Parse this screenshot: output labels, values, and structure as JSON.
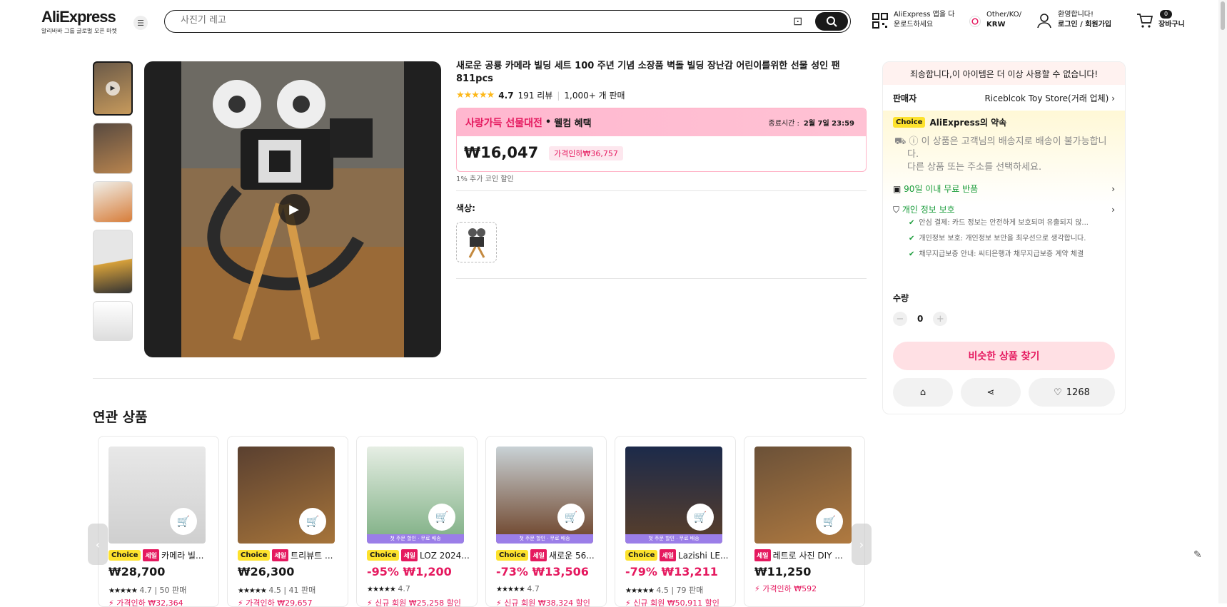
{
  "header": {
    "logo": "AliExpress",
    "logo_sub": "알리바바 그룹 글로벌 오픈 마켓",
    "search_placeholder": "사진기 레고",
    "app_line1": "AliExpress 앱을 다",
    "app_line2": "운로드하세요",
    "lang_line1": "Other/KO/",
    "lang_line2": "KRW",
    "user_line1": "환영합니다!",
    "user_line2": "로그인 / 회원가입",
    "cart_count": "0",
    "cart_label": "장바구니"
  },
  "product": {
    "title": "새로운 공룡 카메라 빌딩 세트 100 주년 기념 소장품 벽돌 빌딩 장난감 어린이를위한 선물 성인 팬 811pcs",
    "rating": "4.7",
    "reviews": "191 리뷰",
    "sold": "1,000+ 개 판매",
    "promo_brand": "사랑가득 선물대전",
    "promo_sep": "•",
    "promo_welcome": "웰컴 혜택",
    "end_label": "종료시간 :",
    "end_time": "2월 7일 23:59",
    "price": "₩16,047",
    "discount": "가격인하₩36,757",
    "coin": "1% 추가 코인 할인",
    "color_label": "색상:"
  },
  "panel": {
    "notice": "죄송합니다,이 아이템은 더 이상 사용할 수 없습니다!",
    "seller_label": "판매자",
    "seller_name": "Riceblcok Toy Store(거래 업체)",
    "choice_chip": "Choice",
    "promise": "AliExpress의 약속",
    "ship_line1": "이 상품은 고객님의 배송지로 배송이 불가능합니",
    "ship_line2": "다.",
    "ship_line3": "다른 상품 또는 주소를 선택하세요.",
    "returns": "90일 이내 무료 반품",
    "privacy": "개인 정보 보호",
    "privacy_items": [
      "안심 결제: 카드 정보는 안전하게 보호되며 유출되지 않...",
      "개인정보 보호: 개인정보 보안을 최우선으로 생각합니다.",
      "채무지급보증 안내: 씨티은행과 채무지급보증 계약 체결"
    ],
    "qty_label": "수량",
    "qty_value": "0",
    "similar_btn": "비슷한 상품 찾기",
    "wishlist_count": "1268"
  },
  "related": {
    "title": "연관 상품",
    "banner_text": "첫 주문 할인 · 무료 배송",
    "items": [
      {
        "name": "카메라 빌...",
        "price": "₩28,700",
        "rating": "4.7",
        "sold": "50 판매",
        "disc": "가격인하 ₩32,364"
      },
      {
        "name": "트리뷰트 ...",
        "price": "₩26,300",
        "rating": "4.5",
        "sold": "41 판매",
        "disc": "가격인하 ₩29,657"
      },
      {
        "name": "LOZ 2024...",
        "pct": "-95%",
        "price": "₩1,200",
        "rating": "4.7",
        "sold": "",
        "disc": "신규 회원 ₩25,258 할인"
      },
      {
        "name": "새로운 56...",
        "pct": "-73%",
        "price": "₩13,506",
        "rating": "4.7",
        "sold": "",
        "disc": "신규 회원 ₩38,324 할인"
      },
      {
        "name": "Lazishi LE...",
        "pct": "-79%",
        "price": "₩13,211",
        "rating": "4.5",
        "sold": "79 판매",
        "disc": "신규 회원 ₩50,911 할인"
      },
      {
        "name": "레트로 사진 DIY ...",
        "price": "₩11,250",
        "rating": "",
        "sold": "",
        "disc": "가격인하 ₩592"
      }
    ]
  },
  "colors": {
    "accent": "#e5195f",
    "choice": "#fde22d",
    "green": "#1a9c3a"
  }
}
